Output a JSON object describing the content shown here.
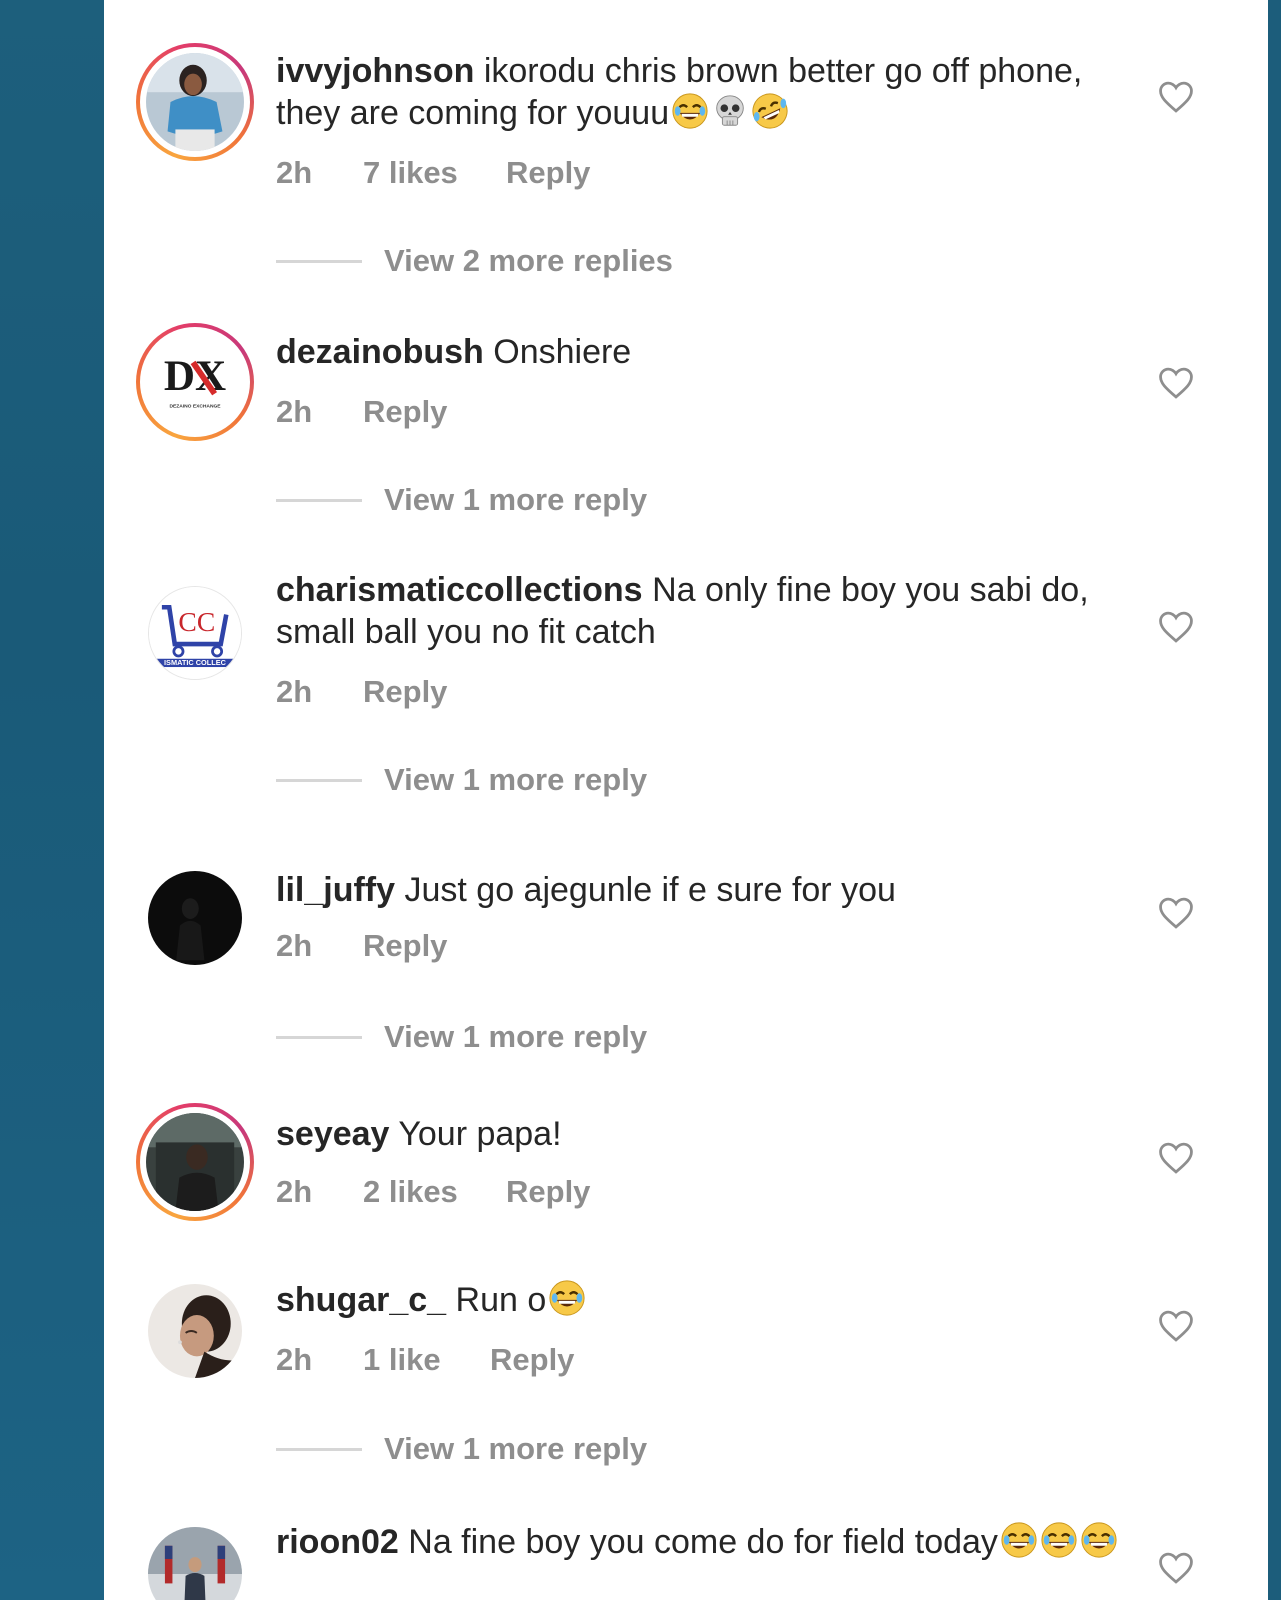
{
  "comments": [
    {
      "username": "ivvyjohnson",
      "text": "ikorodu chris brown better go off phone, they are coming for youuu",
      "emojis": [
        "joy-face-icon",
        "skull-icon",
        "rofl-face-icon"
      ],
      "time": "2h",
      "likes": "7 likes",
      "reply": "Reply",
      "view_replies": "View 2 more replies"
    },
    {
      "username": "dezainobush",
      "text": "Onshiere",
      "time": "2h",
      "reply": "Reply",
      "view_replies": "View 1 more reply"
    },
    {
      "username": "charismaticcollections",
      "text": "Na only fine boy you sabi do, small ball you no fit catch",
      "time": "2h",
      "reply": "Reply",
      "view_replies": "View 1 more reply"
    },
    {
      "username": "lil_juffy",
      "text": "Just go ajegunle if e sure for you",
      "time": "2h",
      "reply": "Reply",
      "view_replies": "View 1 more reply"
    },
    {
      "username": "seyeay",
      "text": "Your papa!",
      "time": "2h",
      "likes": "2 likes",
      "reply": "Reply"
    },
    {
      "username": "shugar_c_",
      "text": "Run o",
      "emojis": [
        "joy-face-icon"
      ],
      "time": "2h",
      "likes": "1 like",
      "reply": "Reply",
      "view_replies": "View 1 more reply"
    },
    {
      "username": "rioon02",
      "text": "Na fine boy you come do for field today",
      "emojis": [
        "joy-face-icon",
        "joy-face-icon",
        "joy-face-icon"
      ]
    }
  ],
  "avatar_texts": {
    "dx_logo": "DX",
    "dx_sub": "DEZAINO EXCHANGE",
    "cc_logo": "CC",
    "cc_banner": "ISMATIC COLLEC"
  },
  "colors": {
    "background": "#1d5f7c",
    "text": "#262626",
    "muted": "#8e8e8e",
    "story_ring": [
      "#f9a53e",
      "#e33d69"
    ]
  }
}
